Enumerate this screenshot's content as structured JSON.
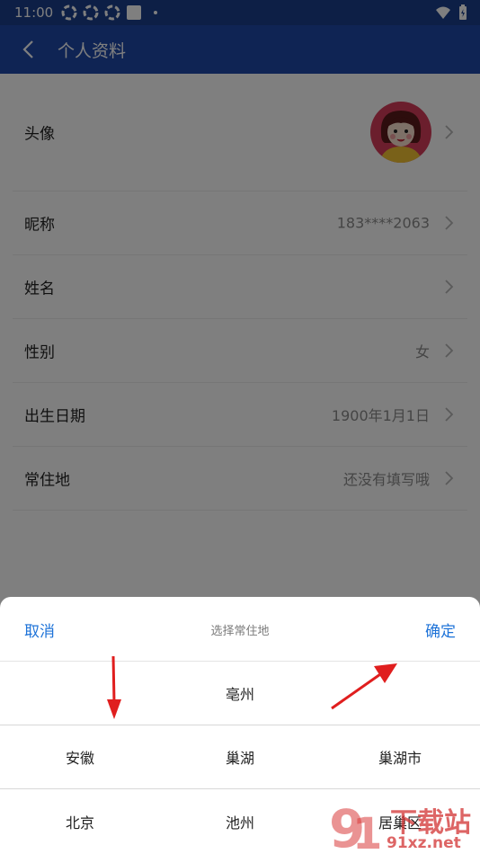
{
  "status_bar": {
    "time": "11:00"
  },
  "app_bar": {
    "title": "个人资料"
  },
  "profile_rows": [
    {
      "label": "头像",
      "value": ""
    },
    {
      "label": "昵称",
      "value": "183****2063"
    },
    {
      "label": "姓名",
      "value": ""
    },
    {
      "label": "性别",
      "value": "女"
    },
    {
      "label": "出生日期",
      "value": "1900年1月1日"
    },
    {
      "label": "常住地",
      "value": "还没有填写哦"
    }
  ],
  "picker": {
    "cancel_label": "取消",
    "title": "选择常住地",
    "confirm_label": "确定",
    "rows": [
      [
        "",
        "亳州",
        ""
      ],
      [
        "安徽",
        "巢湖",
        "巢湖市"
      ],
      [
        "北京",
        "池州",
        "居巢区"
      ]
    ]
  },
  "watermark": {
    "brand": "下载站",
    "url": "91xz.net"
  },
  "colors": {
    "app_bar": "#1e49a8",
    "status_bar": "#1b3e8c",
    "accent": "#1e73d8",
    "annotation_arrow": "#e01e1e"
  }
}
